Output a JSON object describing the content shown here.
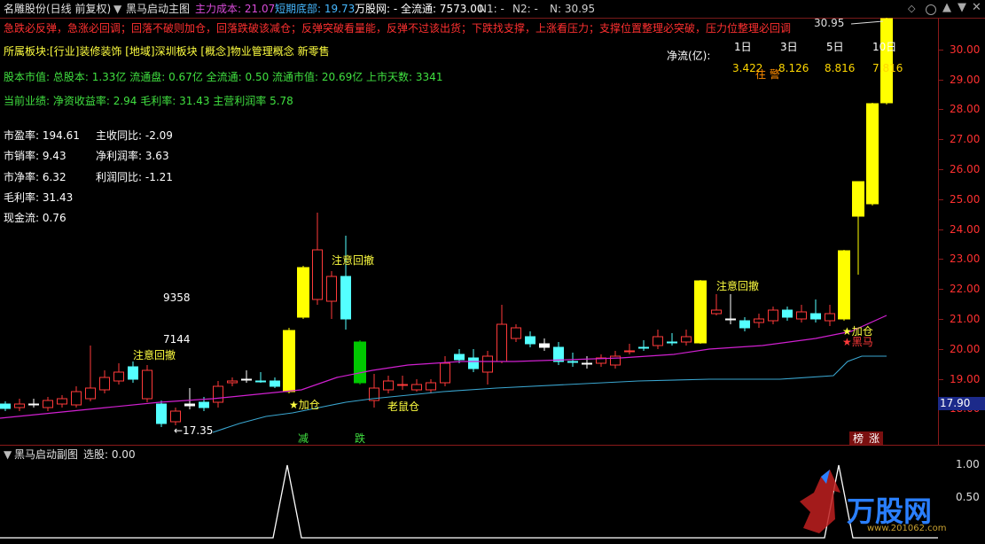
{
  "header": {
    "title": "名雕股份(日线 前复权)",
    "indicator_name": "黑马启动主图",
    "main_cost": "主力成本: 21.07",
    "short_bottom": "短期底部: 19.73",
    "site": "万股网: - 全流通: 7573.00",
    "n1": "N1: -",
    "n2": "N2: -",
    "n": "N: 30.95"
  },
  "warning_line": "急跌必反弹，急涨必回调；回落不破则加仓，回落跌破该减仓；反弹突破看量能，反弹不过该出货；下跌找支撑，上涨看压力；支撑位置整理必突破，压力位整理必回调",
  "info": {
    "sector": "所属板块:[行业]装修装饰 [地域]深圳板块 [概念]物业管理概念 新零售",
    "market_value": "股本市值: 总股本: 1.33亿 流通盘: 0.67亿 全流通: 0.50 流通市值: 20.69亿 上市天数: 3341",
    "performance": "当前业绩: 净资收益率: 2.94 毛利率: 31.43 主营利润率 5.78"
  },
  "fundamentals_left": [
    {
      "label": "市盈率: 194.61"
    },
    {
      "label": "市销率: 9.43"
    },
    {
      "label": "市净率: 6.32"
    },
    {
      "label": "毛利率: 31.43"
    },
    {
      "label": "现金流: 0.76"
    }
  ],
  "fundamentals_right": [
    {
      "label": "主收同比: -2.09"
    },
    {
      "label": "净利润率: 3.63"
    },
    {
      "label": "利润同比: -1.21"
    }
  ],
  "net_flow": {
    "label": "净流(亿):",
    "periods": [
      "1日",
      "3日",
      "5日",
      "10日"
    ],
    "values": [
      "3.422",
      "8.126",
      "8.816",
      "7.816"
    ],
    "warn": "往 警"
  },
  "price_axis": {
    "ticks": [
      "30.00",
      "29.00",
      "28.00",
      "27.00",
      "26.00",
      "25.00",
      "24.00",
      "23.00",
      "22.00",
      "21.00",
      "20.00",
      "19.00",
      "18.00"
    ],
    "current_tag": "17.90",
    "high_label": "30.95"
  },
  "annotations": {
    "attention_1": "注意回撤",
    "attention_2": "注意回撤",
    "attention_3": "注意回撤",
    "add_1": "★加仓",
    "add_2": "★加仓",
    "heima": "★黑马",
    "laoshu": "老鼠仓",
    "low_label": "←17.35",
    "vol_1": "9358",
    "vol_2": "7144",
    "jian": "减",
    "die": "跌",
    "bang": "榜",
    "zhang": "涨"
  },
  "sub_panel": {
    "title": "黑马启动副图",
    "select_label": "选股: 0.00",
    "ticks": [
      "1.00",
      "0.50"
    ],
    "watermark": "万股网",
    "watermark_url": "www.201062.com"
  },
  "colors": {
    "up": "#ff3a3a",
    "down": "#54ffff",
    "yellow": "#ffff00",
    "green_bar": "#00c800",
    "ma_magenta": "#d020d0",
    "ma_blue": "#3aa6d0",
    "axis_red": "#8b1a1a"
  }
}
